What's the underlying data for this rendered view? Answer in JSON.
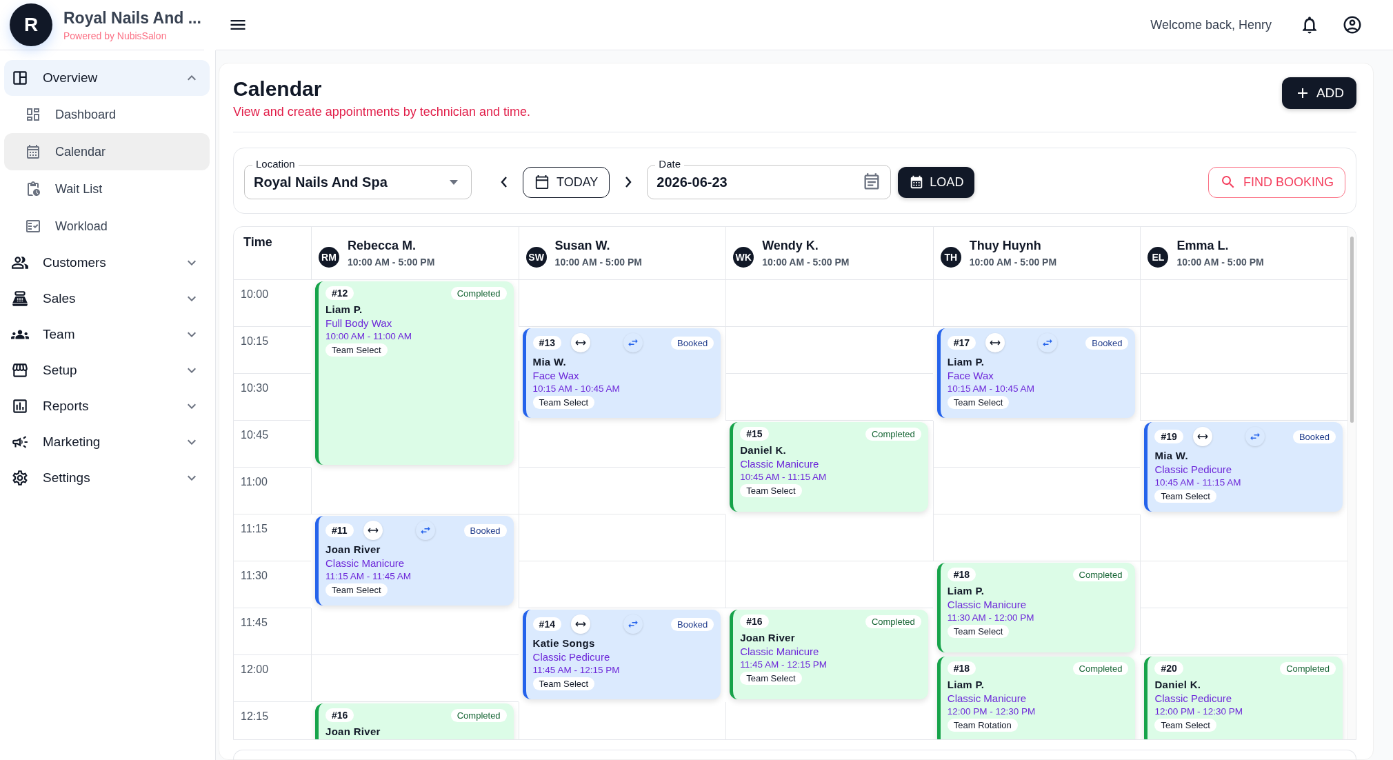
{
  "brand": {
    "initial": "R",
    "title": "Royal Nails And ...",
    "subtitle": "Powered by NubisSalon"
  },
  "topbar": {
    "welcome": "Welcome back, Henry"
  },
  "sidebar": {
    "items": [
      {
        "label": "Overview",
        "expanded": true,
        "children": [
          {
            "label": "Dashboard",
            "selected": false
          },
          {
            "label": "Calendar",
            "selected": true
          },
          {
            "label": "Wait List",
            "selected": false
          },
          {
            "label": "Workload",
            "selected": false
          }
        ]
      },
      {
        "label": "Customers",
        "expanded": false
      },
      {
        "label": "Sales",
        "expanded": false
      },
      {
        "label": "Team",
        "expanded": false
      },
      {
        "label": "Setup",
        "expanded": false
      },
      {
        "label": "Reports",
        "expanded": false
      },
      {
        "label": "Marketing",
        "expanded": false
      },
      {
        "label": "Settings",
        "expanded": false
      }
    ]
  },
  "page": {
    "title": "Calendar",
    "subtitle": "View and create appointments by technician and time.",
    "add_button": "ADD"
  },
  "filters": {
    "location": {
      "label": "Location",
      "value": "Royal Nails And Spa"
    },
    "today_button": "TODAY",
    "date": {
      "label": "Date",
      "value": "2026-06-23"
    },
    "load_button": "LOAD",
    "find_button": "FIND BOOKING"
  },
  "calendar": {
    "time_heading": "Time",
    "technicians": [
      {
        "initials": "RM",
        "name": "Rebecca M.",
        "hours": "10:00 AM - 5:00 PM"
      },
      {
        "initials": "SW",
        "name": "Susan W.",
        "hours": "10:00 AM - 5:00 PM"
      },
      {
        "initials": "WK",
        "name": "Wendy K.",
        "hours": "10:00 AM - 5:00 PM"
      },
      {
        "initials": "TH",
        "name": "Thuy Huynh",
        "hours": "10:00 AM - 5:00 PM"
      },
      {
        "initials": "EL",
        "name": "Emma L.",
        "hours": "10:00 AM - 5:00 PM"
      }
    ],
    "rows": [
      {
        "time": "10:00",
        "cells": [
          {
            "kind": "completed",
            "number": "#12",
            "status": "Completed",
            "client": "Liam P.",
            "service": "Full Body Wax",
            "time": "10:00 AM - 11:00 AM",
            "tag": "Team Select"
          },
          {
            "kind": "empty"
          },
          {
            "kind": "empty"
          },
          {
            "kind": "empty"
          },
          {
            "kind": "empty"
          }
        ]
      },
      {
        "time": "10:15",
        "cells": [
          {
            "kind": "continued"
          },
          {
            "kind": "booked",
            "number": "#13",
            "status": "Booked",
            "client": "Mia W.",
            "service": "Face Wax",
            "time": "10:15 AM - 10:45 AM",
            "tag": "Team Select"
          },
          {
            "kind": "empty"
          },
          {
            "kind": "booked",
            "number": "#17",
            "status": "Booked",
            "client": "Liam P.",
            "service": "Face Wax",
            "time": "10:15 AM - 10:45 AM",
            "tag": "Team Select"
          },
          {
            "kind": "empty"
          }
        ]
      },
      {
        "time": "10:30",
        "cells": [
          {
            "kind": "continued"
          },
          {
            "kind": "continued"
          },
          {
            "kind": "empty"
          },
          {
            "kind": "continued"
          },
          {
            "kind": "empty"
          }
        ]
      },
      {
        "time": "10:45",
        "cells": [
          {
            "kind": "continued"
          },
          {
            "kind": "empty"
          },
          {
            "kind": "completed",
            "number": "#15",
            "status": "Completed",
            "client": "Daniel K.",
            "service": "Classic Manicure",
            "time": "10:45 AM - 11:15 AM",
            "tag": "Team Select"
          },
          {
            "kind": "empty"
          },
          {
            "kind": "booked",
            "number": "#19",
            "status": "Booked",
            "client": "Mia W.",
            "service": "Classic Pedicure",
            "time": "10:45 AM - 11:15 AM",
            "tag": "Team Select"
          }
        ]
      },
      {
        "time": "11:00",
        "cells": [
          {
            "kind": "empty"
          },
          {
            "kind": "empty"
          },
          {
            "kind": "continued"
          },
          {
            "kind": "empty"
          },
          {
            "kind": "continued"
          }
        ]
      },
      {
        "time": "11:15",
        "cells": [
          {
            "kind": "booked",
            "number": "#11",
            "status": "Booked",
            "client": "Joan River",
            "service": "Classic Manicure",
            "time": "11:15 AM - 11:45 AM",
            "tag": "Team Select"
          },
          {
            "kind": "empty"
          },
          {
            "kind": "empty"
          },
          {
            "kind": "empty"
          },
          {
            "kind": "empty"
          }
        ]
      },
      {
        "time": "11:30",
        "cells": [
          {
            "kind": "continued"
          },
          {
            "kind": "empty"
          },
          {
            "kind": "empty"
          },
          {
            "kind": "completed",
            "number": "#18",
            "status": "Completed",
            "client": "Liam P.",
            "service": "Classic Manicure",
            "time": "11:30 AM - 12:00 PM",
            "tag": "Team Select"
          },
          {
            "kind": "empty"
          }
        ]
      },
      {
        "time": "11:45",
        "cells": [
          {
            "kind": "empty"
          },
          {
            "kind": "booked",
            "number": "#14",
            "status": "Booked",
            "client": "Katie Songs",
            "service": "Classic Pedicure",
            "time": "11:45 AM - 12:15 PM",
            "tag": "Team Select"
          },
          {
            "kind": "completed",
            "number": "#16",
            "status": "Completed",
            "client": "Joan River",
            "service": "Classic Manicure",
            "time": "11:45 AM - 12:15 PM",
            "tag": "Team Select"
          },
          {
            "kind": "continued"
          },
          {
            "kind": "empty"
          }
        ]
      },
      {
        "time": "12:00",
        "cells": [
          {
            "kind": "empty"
          },
          {
            "kind": "continued"
          },
          {
            "kind": "continued"
          },
          {
            "kind": "completed",
            "number": "#18",
            "status": "Completed",
            "client": "Liam P.",
            "service": "Classic Manicure",
            "time": "12:00 PM - 12:30 PM",
            "tag": "Team Rotation"
          },
          {
            "kind": "completed",
            "number": "#20",
            "status": "Completed",
            "client": "Daniel K.",
            "service": "Classic Pedicure",
            "time": "12:00 PM - 12:30 PM",
            "tag": "Team Select"
          }
        ]
      },
      {
        "time": "12:15",
        "cells": [
          {
            "kind": "completed",
            "number": "#16",
            "status": "Completed",
            "client": "Joan River"
          },
          {
            "kind": "empty"
          },
          {
            "kind": "empty"
          },
          {
            "kind": "continued"
          },
          {
            "kind": "continued"
          }
        ]
      }
    ]
  }
}
